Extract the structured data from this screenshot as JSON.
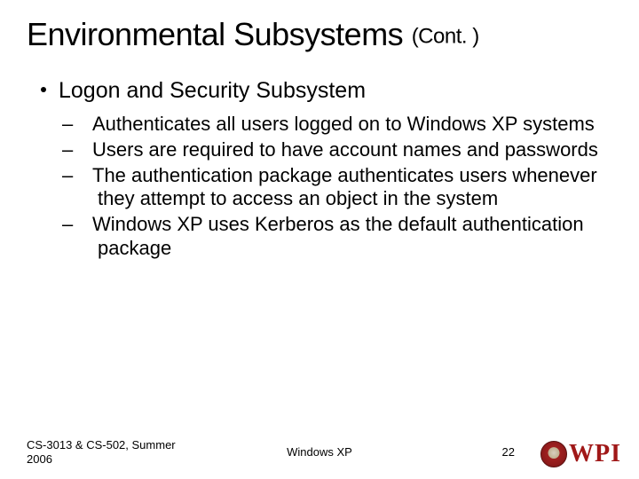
{
  "title_main": "Environmental Subsystems ",
  "title_cont": "(Cont. )",
  "bullet": "Logon and Security Subsystem",
  "subs": [
    "Authenticates all users logged on to Windows XP systems",
    "Users are required to have account names and passwords",
    "The authentication package authenticates users whenever they attempt to access an object in the system",
    "Windows XP uses Kerberos as the default authentication package"
  ],
  "footer": {
    "course": "CS-3013 & CS-502, Summer 2006",
    "topic": "Windows XP",
    "page": "22"
  },
  "logo_text": "WPI"
}
